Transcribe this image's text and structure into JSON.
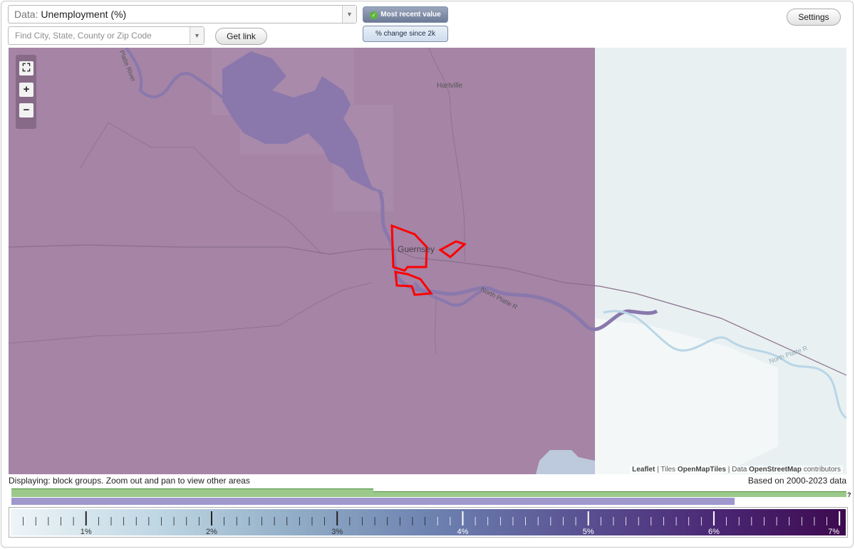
{
  "data_select": {
    "prefix": "Data:",
    "value": "Unemployment (%)"
  },
  "search": {
    "placeholder": "Find City, State, County or Zip Code"
  },
  "buttons": {
    "get_link": "Get link",
    "settings": "Settings",
    "most_recent": "Most recent value",
    "pct_change": "% change since 2k"
  },
  "icons": {
    "dropdown": "chevron-down-icon",
    "check": "check-icon",
    "fullscreen": "fullscreen-icon",
    "zoom_in": "plus-icon",
    "zoom_out": "minus-icon"
  },
  "map": {
    "labels": {
      "hartville": "Hartville",
      "guernsey": "Guernsey",
      "river1": "North Platte R",
      "river2": "North Platte R",
      "river_top": "Platte River"
    },
    "attribution": {
      "leaflet": "Leaflet",
      "sep1": " | Tiles ",
      "tiles": "OpenMapTiles",
      "sep2": " | Data ",
      "data": "OpenStreetMap",
      "contrib": " contributors"
    },
    "colors": {
      "region": "#a584a6",
      "water": "#8a78ac",
      "selection": "#ff0000",
      "outside": "#e8f0f2"
    }
  },
  "info": {
    "displaying": "Displaying: block groups. Zoom out and pan to view other areas",
    "based_on": "Based on 2000-2023 data",
    "help": "?"
  },
  "chart_data": {
    "type": "bar",
    "bars": [
      {
        "name": "",
        "color": "#9bc98b"
      },
      {
        "name": "",
        "color": "#9e98cd"
      }
    ]
  },
  "legend": {
    "ticks": [
      "1%",
      "2%",
      "3%",
      "4%",
      "5%",
      "6%",
      "7%"
    ],
    "min": 0.4,
    "max": 7.05
  }
}
